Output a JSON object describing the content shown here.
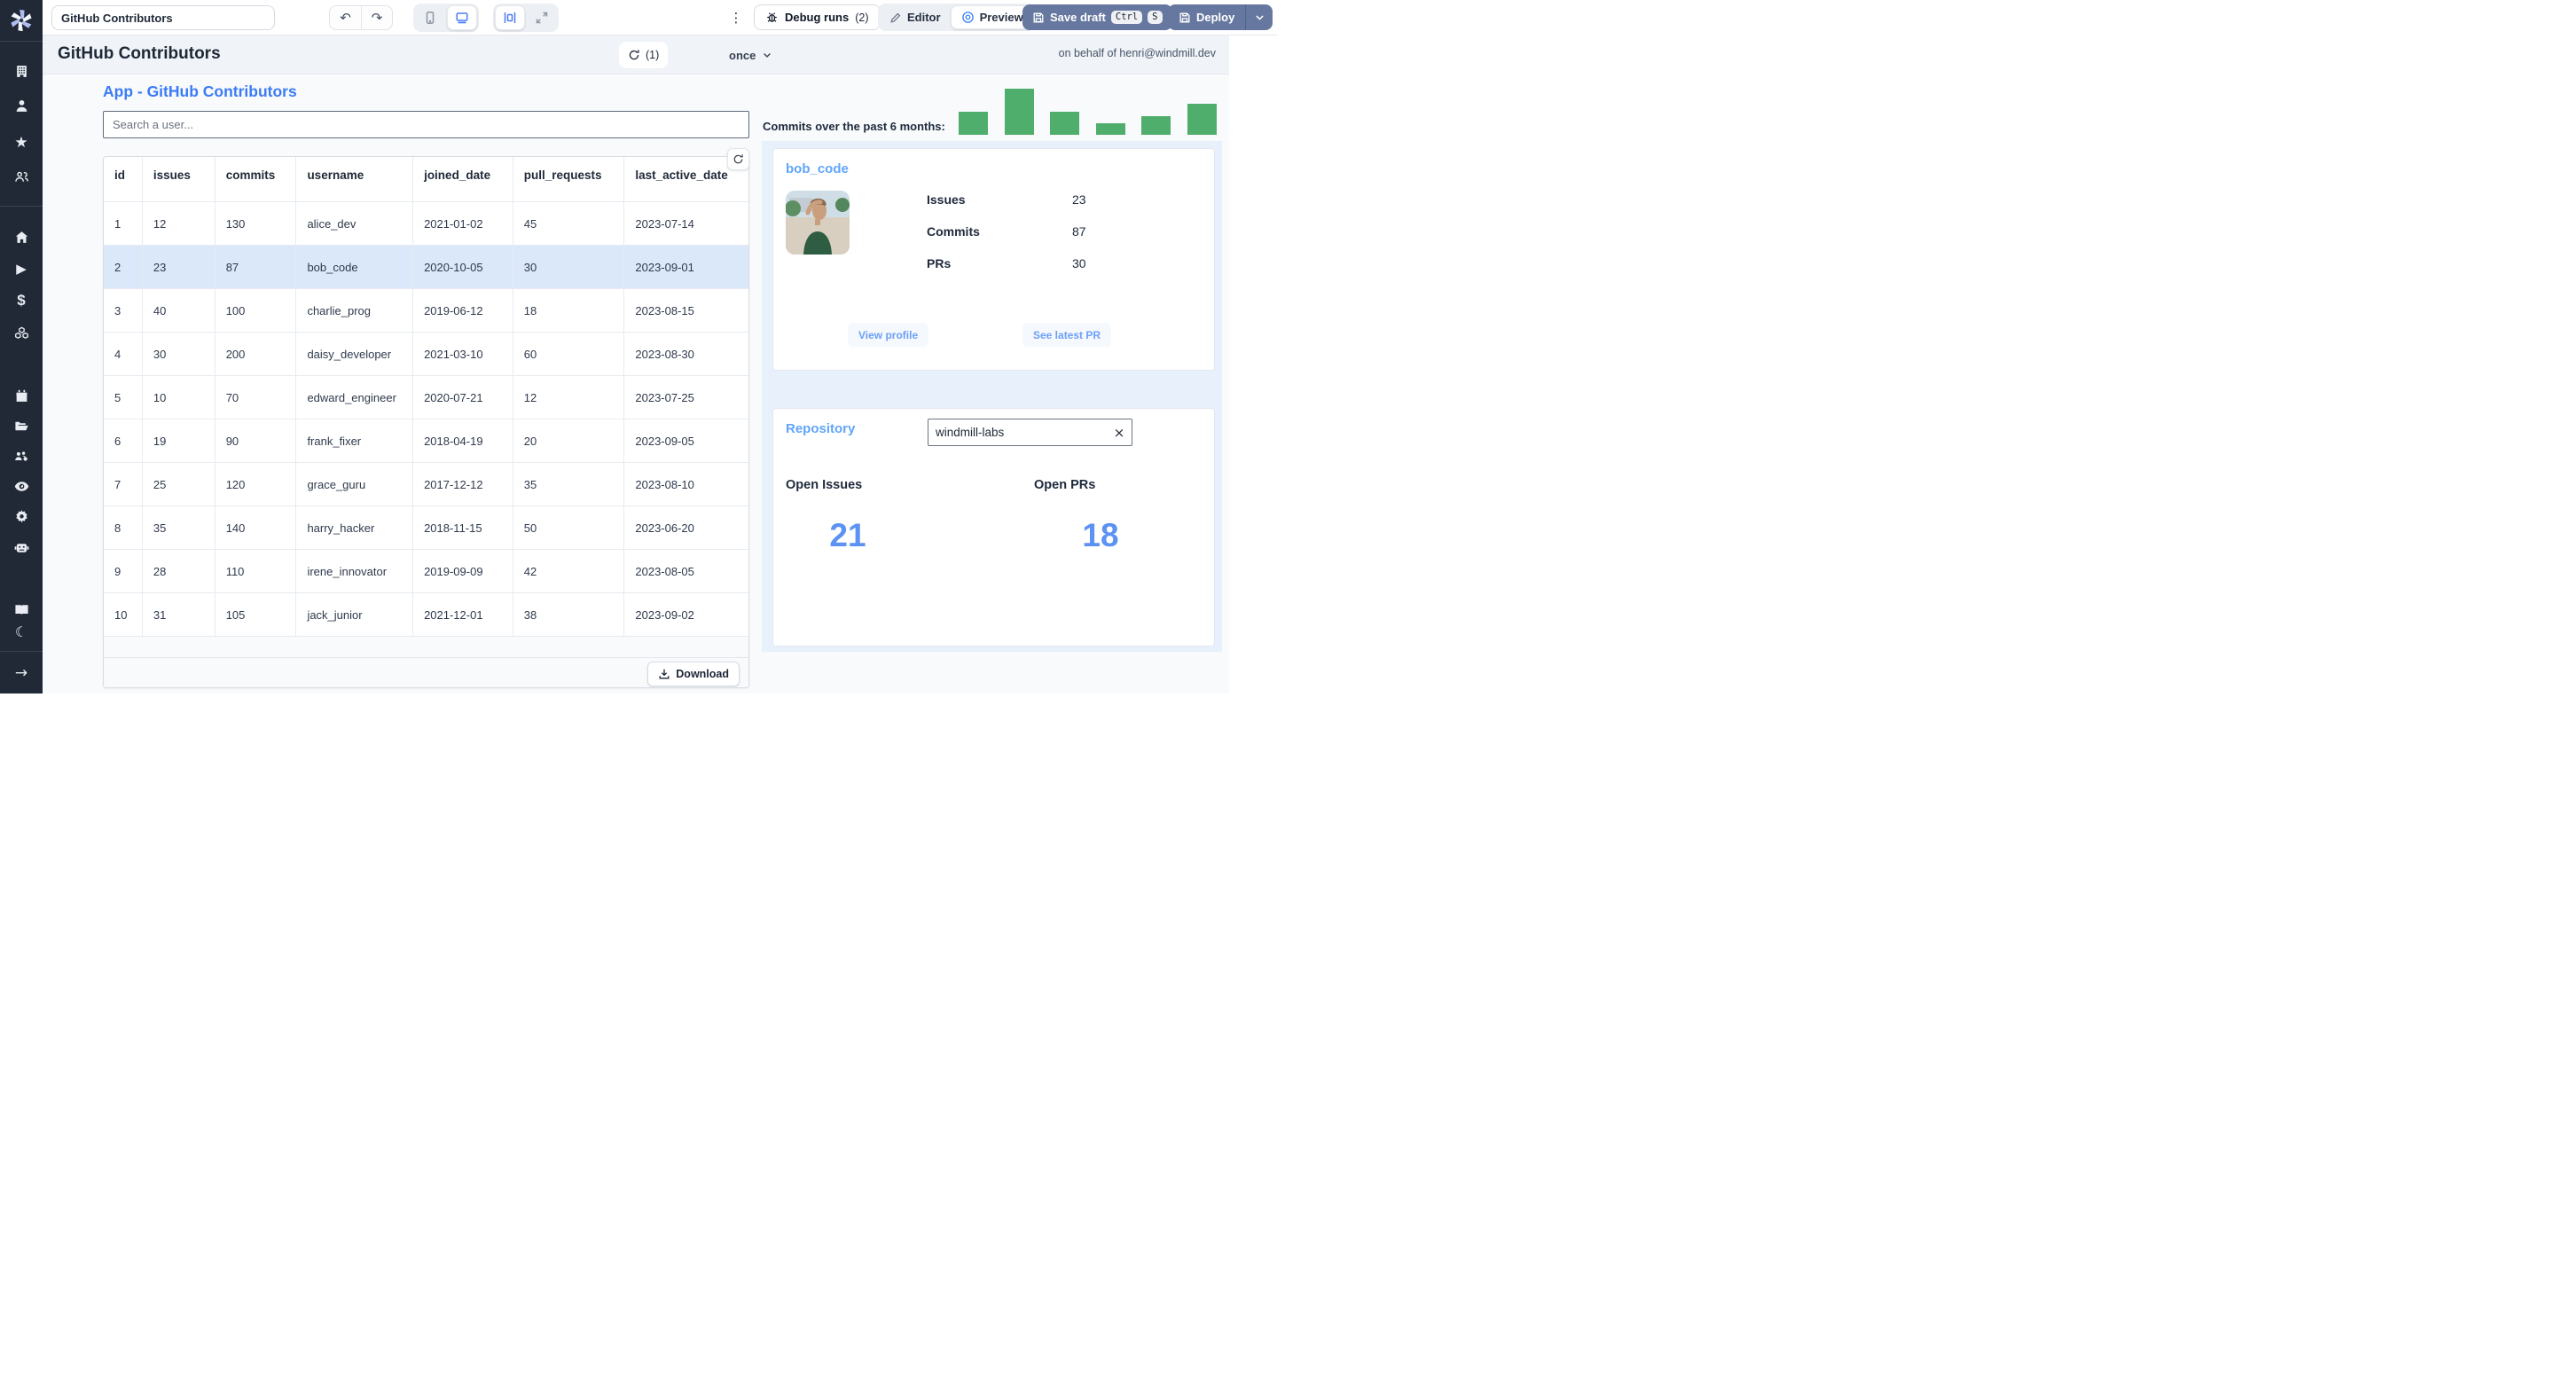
{
  "topbar": {
    "app_title_input": "GitHub Contributors",
    "debug_runs_label": "Debug runs",
    "debug_runs_count": "(2)",
    "editor_label": "Editor",
    "preview_label": "Preview",
    "save_draft_label": "Save draft",
    "kbd_ctrl": "Ctrl",
    "kbd_s": "S",
    "deploy_label": "Deploy"
  },
  "header": {
    "title": "GitHub Contributors",
    "refresh_count": "(1)",
    "schedule_label": "once",
    "on_behalf": "on behalf of henri@windmill.dev"
  },
  "app": {
    "heading": "App - GitHub Contributors",
    "search_placeholder": "Search a user...",
    "download_label": "Download"
  },
  "table": {
    "columns": [
      "id",
      "issues",
      "commits",
      "username",
      "joined_date",
      "pull_requests",
      "last_active_date"
    ],
    "selected_row_id": 2,
    "rows": [
      [
        1,
        12,
        130,
        "alice_dev",
        "2021-01-02",
        45,
        "2023-07-14"
      ],
      [
        2,
        23,
        87,
        "bob_code",
        "2020-10-05",
        30,
        "2023-09-01"
      ],
      [
        3,
        40,
        100,
        "charlie_prog",
        "2019-06-12",
        18,
        "2023-08-15"
      ],
      [
        4,
        30,
        200,
        "daisy_developer",
        "2021-03-10",
        60,
        "2023-08-30"
      ],
      [
        5,
        10,
        70,
        "edward_engineer",
        "2020-07-21",
        12,
        "2023-07-25"
      ],
      [
        6,
        19,
        90,
        "frank_fixer",
        "2018-04-19",
        20,
        "2023-09-05"
      ],
      [
        7,
        25,
        120,
        "grace_guru",
        "2017-12-12",
        35,
        "2023-08-10"
      ],
      [
        8,
        35,
        140,
        "harry_hacker",
        "2018-11-15",
        50,
        "2023-06-20"
      ],
      [
        9,
        28,
        110,
        "irene_innovator",
        "2019-09-09",
        42,
        "2023-08-05"
      ],
      [
        10,
        31,
        105,
        "jack_junior",
        "2021-12-01",
        38,
        "2023-09-02"
      ]
    ]
  },
  "chart_data": {
    "type": "bar",
    "title": "Commits over the past 6 months:",
    "values": [
      50,
      100,
      50,
      25,
      40,
      67
    ],
    "bar_color": "#4fae6c"
  },
  "profile_card": {
    "username": "bob_code",
    "stats": [
      {
        "label": "Issues",
        "value": "23"
      },
      {
        "label": "Commits",
        "value": "87"
      },
      {
        "label": "PRs",
        "value": "30"
      }
    ],
    "view_profile_label": "View profile",
    "see_latest_pr_label": "See latest PR"
  },
  "repository_card": {
    "heading": "Repository",
    "input_value": "windmill-labs",
    "open_issues_label": "Open Issues",
    "open_issues_value": "21",
    "open_prs_label": "Open PRs",
    "open_prs_value": "18"
  },
  "colors": {
    "sidebar_bg": "#212936",
    "accent_blue": "#3b7bf6",
    "card_heading_blue": "#60a5fa",
    "big_number_blue": "#5b92f3",
    "bar_green": "#4fae6c",
    "selected_row": "#dbe8f9",
    "panel_blue": "#e8f1fb",
    "slate_button": "#66789f"
  },
  "icons": {
    "windmill-logo": "six-blade pinwheel",
    "undo": "curved-arrow-left",
    "redo": "curved-arrow-right",
    "mobile": "phone outline",
    "desktop": "monitor outline",
    "padding": "bars-around-box",
    "expand": "diagonal arrows",
    "kebab": "vertical dots",
    "bug": "debug bug",
    "pencil": "edit pencil",
    "eye": "preview eye",
    "floppy": "save disk",
    "chevron-down": "v",
    "refresh": "circular arrows",
    "download": "arrow into tray",
    "close": "x"
  }
}
